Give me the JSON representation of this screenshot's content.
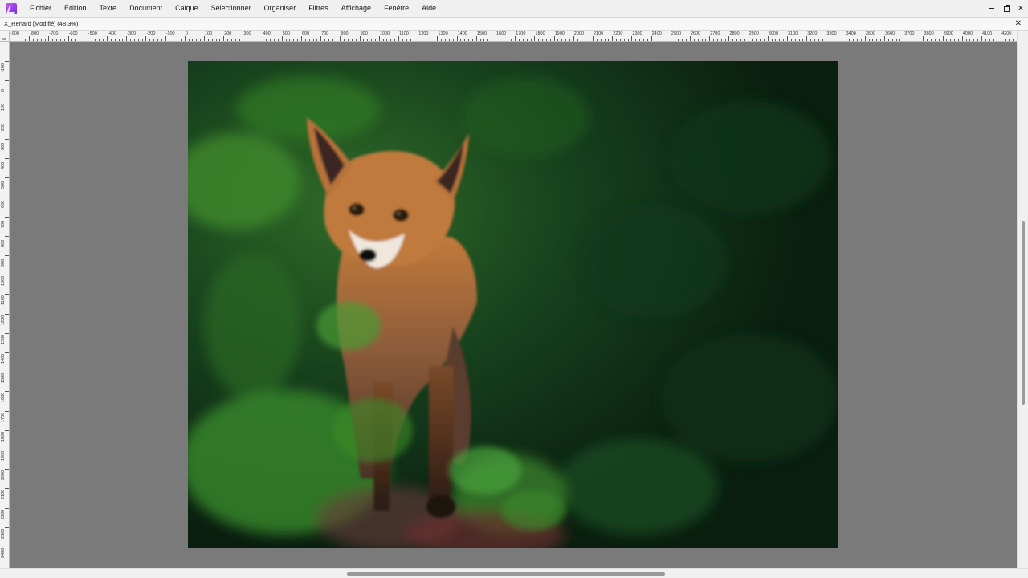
{
  "menubar": {
    "app_icon": "affinity-photo-icon",
    "items": [
      "Fichier",
      "Édition",
      "Texte",
      "Document",
      "Calque",
      "Sélectionner",
      "Organiser",
      "Filtres",
      "Affichage",
      "Fenêtre",
      "Aide"
    ]
  },
  "window_controls": {
    "minimize": "minimize-icon",
    "restore": "restore-icon",
    "close": "✕"
  },
  "document": {
    "title": "X_Renard [Modifié] (48.3%)",
    "close": "✕"
  },
  "ruler": {
    "unit": "px",
    "top_labels": [
      "-900",
      "-800",
      "-700",
      "-600",
      "-500",
      "-400",
      "-300",
      "-200",
      "-100",
      "0",
      "100",
      "200",
      "300",
      "400",
      "500",
      "600",
      "700",
      "800",
      "900",
      "1000",
      "1100",
      "1200",
      "1300",
      "1400",
      "1500",
      "1600",
      "1700",
      "1800",
      "1900",
      "2000",
      "2100",
      "2200",
      "2300",
      "2400",
      "2500",
      "2600",
      "2700",
      "2800",
      "2900",
      "3000",
      "3100",
      "3200",
      "3300",
      "3400",
      "3500",
      "3600",
      "3700",
      "3800",
      "3900",
      "4000",
      "4100",
      "4200"
    ],
    "left_labels": [
      "-100",
      "0",
      "100",
      "200",
      "300",
      "400",
      "500",
      "600",
      "700",
      "800",
      "900",
      "1000",
      "1100",
      "1200",
      "1300",
      "1400",
      "1500",
      "1600",
      "1700",
      "1800",
      "1900",
      "2000",
      "2100",
      "2200",
      "2300",
      "2400",
      "2500",
      "2600"
    ]
  },
  "image": {
    "subject": "fox-cub-photo"
  },
  "colors": {
    "canvas": "#7a7a7a",
    "foliage_dark": "#0f2a16",
    "foliage_light": "#3f8a2a",
    "fur": "#b86a2a"
  }
}
